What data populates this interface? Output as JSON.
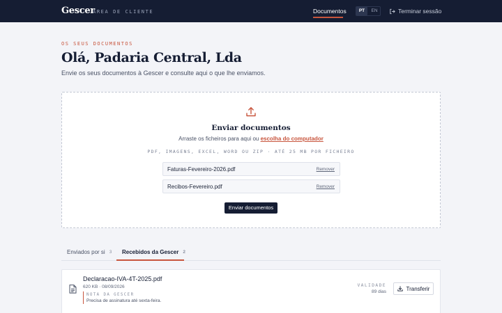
{
  "header": {
    "brand": "Gescer",
    "brand_subtitle": "ÁREA DE CLIENTE",
    "nav_documents": "Documentos",
    "lang_pt": "PT",
    "lang_en": "EN",
    "logout_label": "Terminar sessão",
    "icons": {
      "logout": "logout-icon"
    }
  },
  "hero": {
    "eyebrow": "OS SEUS DOCUMENTOS",
    "title": "Olá, Padaria Central, Lda",
    "subtitle": "Envie os seus documentos à Gescer e consulte aqui o que lhe enviamos."
  },
  "upload": {
    "icon": "upload-icon",
    "title": "Enviar documentos",
    "drag_text": "Arraste os ficheiros para aqui ou",
    "browse_link": "escolha do computador",
    "formats": "PDF, IMAGENS, EXCEL, WORD OU ZIP · ATÉ 25 MB POR FICHEIRO",
    "files": [
      {
        "name": "Faturas-Fevereiro-2026.pdf",
        "remove_label": "Remover"
      },
      {
        "name": "Recibos-Fevereiro.pdf",
        "remove_label": "Remover"
      }
    ],
    "submit_label": "Enviar documentos"
  },
  "tabs": [
    {
      "label": "Enviados por si",
      "count": "3",
      "active": false
    },
    {
      "label": "Recebidos da Gescer",
      "count": "2",
      "active": true
    }
  ],
  "documents": [
    {
      "icon": "document-icon",
      "name": "Declaracao-IVA-4T-2025.pdf",
      "meta": "620 KB · 08/09/2026",
      "note_label": "NOTA DA GESCER",
      "note_text": "Precisa de assinatura até sexta-feira.",
      "validity_label": "VALIDADE",
      "validity_value": "89 dias",
      "download_label": "Transferir"
    }
  ],
  "colors": {
    "header_bg": "#151d33",
    "accent": "#c8553d",
    "page_bg": "#f3f4f8"
  }
}
